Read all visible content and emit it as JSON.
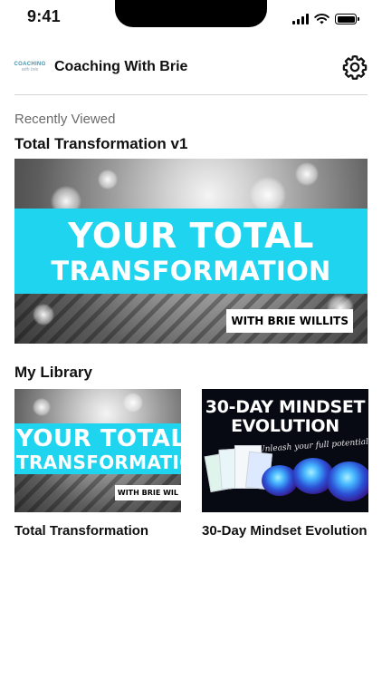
{
  "status_bar": {
    "time": "9:41"
  },
  "header": {
    "logo_text": "COACHING",
    "logo_sub": "with brie",
    "title": "Coaching With Brie",
    "settings_icon": "gear-icon"
  },
  "recently_viewed": {
    "caption": "Recently Viewed",
    "title": "Total Transformation v1",
    "cover": {
      "line1": "YOUR TOTAL",
      "line2": "TRANSFORMATION",
      "tag": "WITH BRIE WILLITS"
    }
  },
  "library": {
    "heading": "My Library",
    "items": [
      {
        "title": "Total Transformation",
        "cover": {
          "line1": "YOUR TOTAL",
          "line2": "TRANSFORMATION",
          "tag": "WITH BRIE WIL"
        }
      },
      {
        "title": "30-Day Mindset Evolution",
        "cover": {
          "line1": "30-DAY MINDSET",
          "line2": "EVOLUTION",
          "subtitle": "Unleash your full potential"
        }
      }
    ]
  },
  "colors": {
    "accent_cyan": "#1fd4ef",
    "text": "#111111",
    "muted": "#6b6b6b",
    "divider": "#d6d6d6"
  }
}
